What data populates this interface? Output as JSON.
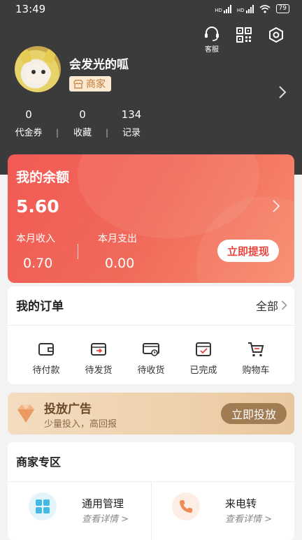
{
  "status_bar": {
    "time": "13:49",
    "battery": "79",
    "net1": "HD",
    "net2": "HD"
  },
  "header": {
    "service_label": "客服",
    "username": "会发光的呱",
    "role_badge": "商家",
    "stats": [
      {
        "value": "0",
        "label": "代金券"
      },
      {
        "value": "0",
        "label": "收藏"
      },
      {
        "value": "134",
        "label": "记录"
      }
    ]
  },
  "balance": {
    "title": "我的余额",
    "amount": "5.60",
    "income_label": "本月收入",
    "income_value": "0.70",
    "expense_label": "本月支出",
    "expense_value": "0.00",
    "withdraw_label": "立即提现"
  },
  "orders": {
    "title": "我的订单",
    "all_label": "全部",
    "items": [
      {
        "label": "待付款",
        "icon": "wallet-icon"
      },
      {
        "label": "待发货",
        "icon": "ship-out-icon"
      },
      {
        "label": "待收货",
        "icon": "truck-icon"
      },
      {
        "label": "已完成",
        "icon": "check-box-icon"
      },
      {
        "label": "购物车",
        "icon": "cart-icon"
      }
    ]
  },
  "ad_banner": {
    "title": "投放广告",
    "subtitle": "少量投入，高回报",
    "button": "立即投放"
  },
  "merchant": {
    "title": "商家专区",
    "items": [
      {
        "name": "通用管理",
        "sub": "查看详情 >",
        "icon": "grid-icon",
        "color": "#43b9e8"
      },
      {
        "name": "来电转",
        "sub": "查看详情 >",
        "icon": "phone-icon",
        "color": "#f08a55"
      }
    ]
  },
  "colors": {
    "accent": "#ef5350",
    "header_bg": "#3b3b3b",
    "ad_button": "#a17b52"
  }
}
